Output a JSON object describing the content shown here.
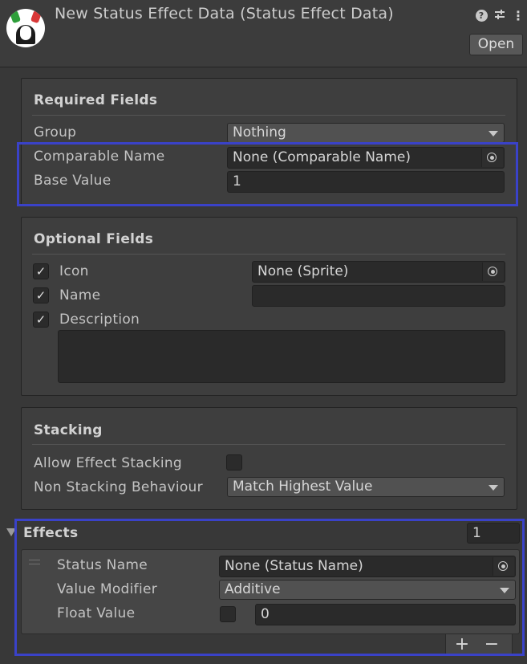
{
  "header": {
    "title": "New Status Effect Data (Status Effect Data)",
    "open_label": "Open",
    "icons": [
      "logo-icon",
      "help-icon",
      "sliders-icon",
      "kebab-menu-icon"
    ]
  },
  "required": {
    "title": "Required Fields",
    "group_label": "Group",
    "group_value": "Nothing",
    "comparable_name_label": "Comparable Name",
    "comparable_name_value": "None (Comparable Name)",
    "base_value_label": "Base Value",
    "base_value": "1"
  },
  "optional": {
    "title": "Optional Fields",
    "icon_label": "Icon",
    "icon_checked": true,
    "icon_value": "None (Sprite)",
    "name_label": "Name",
    "name_checked": true,
    "name_value": "",
    "description_label": "Description",
    "description_checked": true,
    "description_value": ""
  },
  "stacking": {
    "title": "Stacking",
    "allow_label": "Allow Effect Stacking",
    "allow_checked": false,
    "behaviour_label": "Non Stacking Behaviour",
    "behaviour_value": "Match Highest Value"
  },
  "effects": {
    "title": "Effects",
    "count": "1",
    "items": [
      {
        "status_name_label": "Status Name",
        "status_name_value": "None (Status Name)",
        "value_modifier_label": "Value Modifier",
        "value_modifier_value": "Additive",
        "float_value_label": "Float Value",
        "float_enabled": false,
        "float_value": "0"
      }
    ],
    "add_symbol": "+",
    "remove_symbol": "−"
  },
  "colors": {
    "highlight": "#3a42c8",
    "background": "#383838"
  }
}
